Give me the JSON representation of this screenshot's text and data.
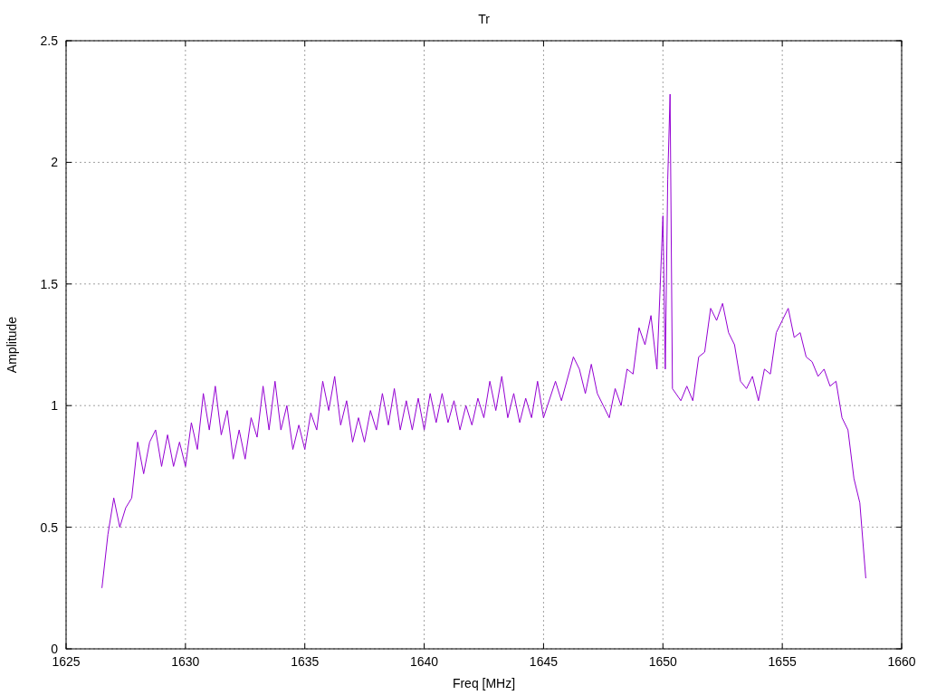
{
  "chart_data": {
    "type": "line",
    "grid": true,
    "title": "Tr",
    "xlabel": "Freq [MHz]",
    "ylabel": "Amplitude",
    "xlim": [
      1625,
      1660
    ],
    "ylim": [
      0,
      2.5
    ],
    "xticks": [
      1625,
      1630,
      1635,
      1640,
      1645,
      1650,
      1655,
      1660
    ],
    "yticks": [
      {
        "value": 0,
        "label": "0"
      },
      {
        "value": 0.5,
        "label": "0.5"
      },
      {
        "value": 1,
        "label": "1"
      },
      {
        "value": 1.5,
        "label": "1.5"
      },
      {
        "value": 2,
        "label": "2"
      },
      {
        "value": 2.5,
        "label": "2.5"
      }
    ],
    "x": [
      1626.5,
      1626.75,
      1627,
      1627.25,
      1627.5,
      1627.75,
      1628,
      1628.25,
      1628.5,
      1628.75,
      1629,
      1629.25,
      1629.5,
      1629.75,
      1630,
      1630.25,
      1630.5,
      1630.75,
      1631,
      1631.25,
      1631.5,
      1631.75,
      1632,
      1632.25,
      1632.5,
      1632.75,
      1633,
      1633.25,
      1633.5,
      1633.75,
      1634,
      1634.25,
      1634.5,
      1634.75,
      1635,
      1635.25,
      1635.5,
      1635.75,
      1636,
      1636.25,
      1636.5,
      1636.75,
      1637,
      1637.25,
      1637.5,
      1637.75,
      1638,
      1638.25,
      1638.5,
      1638.75,
      1639,
      1639.25,
      1639.5,
      1639.75,
      1640,
      1640.25,
      1640.5,
      1640.75,
      1641,
      1641.25,
      1641.5,
      1641.75,
      1642,
      1642.25,
      1642.5,
      1642.75,
      1643,
      1643.25,
      1643.5,
      1643.75,
      1644,
      1644.25,
      1644.5,
      1644.75,
      1645,
      1645.5,
      1645.75,
      1646.25,
      1646.5,
      1646.75,
      1647,
      1647.25,
      1647.5,
      1647.75,
      1648,
      1648.25,
      1648.5,
      1648.75,
      1649,
      1649.25,
      1649.5,
      1649.75,
      1650,
      1650.1,
      1650.2,
      1650.3,
      1650.4,
      1650.75,
      1651,
      1651.25,
      1651.5,
      1651.75,
      1652,
      1652.25,
      1652.5,
      1652.75,
      1653,
      1653.25,
      1653.5,
      1653.75,
      1654,
      1654.25,
      1654.5,
      1654.75,
      1655,
      1655.25,
      1655.5,
      1655.75,
      1656,
      1656.25,
      1656.5,
      1656.75,
      1657,
      1657.25,
      1657.5,
      1657.75,
      1658,
      1658.25,
      1658.5
    ],
    "series": [
      {
        "color": "#9400d3",
        "values": [
          0.25,
          0.47,
          0.62,
          0.5,
          0.58,
          0.62,
          0.85,
          0.72,
          0.85,
          0.9,
          0.75,
          0.88,
          0.75,
          0.85,
          0.75,
          0.93,
          0.82,
          1.05,
          0.9,
          1.08,
          0.88,
          0.98,
          0.78,
          0.9,
          0.78,
          0.95,
          0.87,
          1.08,
          0.9,
          1.1,
          0.9,
          1.0,
          0.82,
          0.92,
          0.82,
          0.97,
          0.9,
          1.1,
          0.98,
          1.12,
          0.92,
          1.02,
          0.85,
          0.95,
          0.85,
          0.98,
          0.9,
          1.05,
          0.92,
          1.07,
          0.9,
          1.02,
          0.9,
          1.03,
          0.9,
          1.05,
          0.93,
          1.05,
          0.93,
          1.02,
          0.9,
          1.0,
          0.92,
          1.03,
          0.95,
          1.1,
          0.98,
          1.12,
          0.95,
          1.05,
          0.93,
          1.03,
          0.95,
          1.1,
          0.95,
          1.1,
          1.02,
          1.2,
          1.15,
          1.05,
          1.17,
          1.05,
          1.0,
          0.95,
          1.07,
          1.0,
          1.15,
          1.13,
          1.32,
          1.25,
          1.37,
          1.15,
          1.78,
          1.15,
          1.93,
          2.28,
          1.07,
          1.02,
          1.08,
          1.02,
          1.2,
          1.22,
          1.4,
          1.35,
          1.42,
          1.3,
          1.25,
          1.1,
          1.07,
          1.12,
          1.02,
          1.15,
          1.13,
          1.3,
          1.35,
          1.4,
          1.28,
          1.3,
          1.2,
          1.18,
          1.12,
          1.15,
          1.08,
          1.1,
          0.95,
          0.9,
          0.7,
          0.6,
          0.29
        ]
      }
    ]
  }
}
